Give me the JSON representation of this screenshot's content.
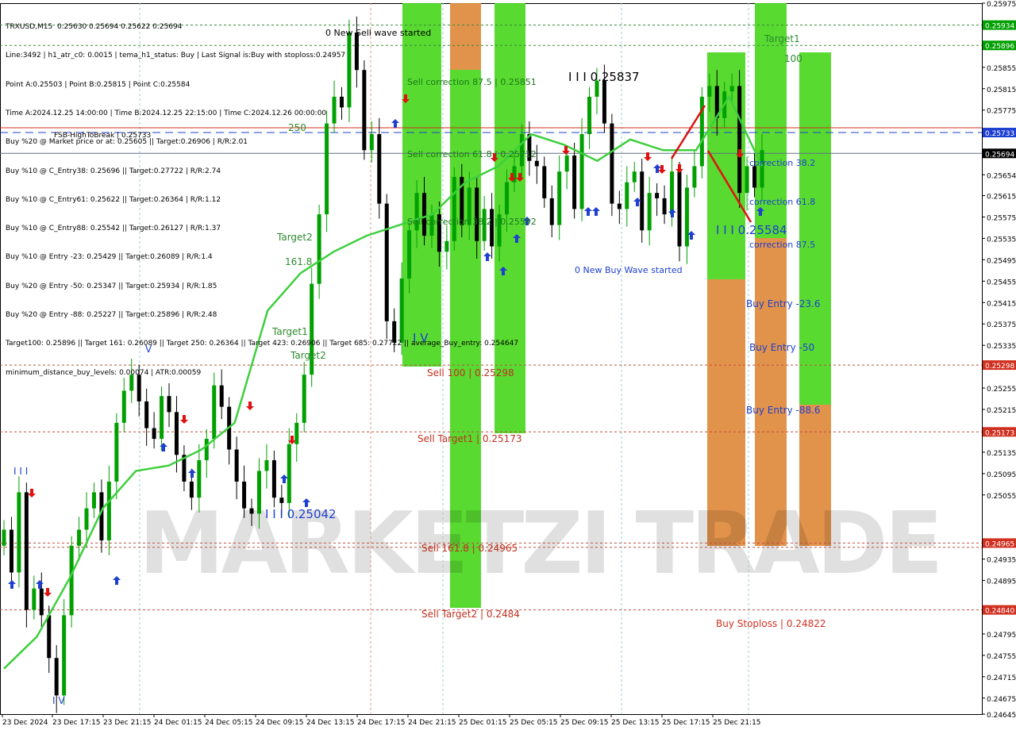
{
  "header_lines": [
    "TRXUSD,M15  0.25630 0.25694 0.25622 0.25694",
    "Line:3492 | h1_atr_c0: 0.0015 | tema_h1_status: Buy | Last Signal is:Buy with stoploss:0.24957",
    "Point A:0.25503 | Point B:0.25815 | Point C:0.25584",
    "Time A:2024.12.25 14:00:00 | Time B:2024.12.25 22:15:00 | Time C:2024.12.26 00:00:00",
    "Buy %20 @ Market price or at: 0.25605 || Target:0.26906 | R/R:2.01",
    "Buy %10 @ C_Entry38: 0.25696 || Target:0.27722 | R/R:2.74",
    "Buy %10 @ C_Entry61: 0.25622 || Target:0.26364 | R/R:1.12",
    "Buy %10 @ C_Entry88: 0.25542 || Target:0.26127 | R/R:1.37",
    "Buy %10 @ Entry -23: 0.25429 || Target:0.26089 | R/R:1.4",
    "Buy %20 @ Entry -50: 0.25347 || Target:0.25934 | R/R:1.85",
    "Buy %20 @ Entry -88: 0.25227 || Target:0.25896 | R/R:2.48",
    "Target100: 0.25896 || Target 161: 0.26089 || Target 250: 0.26364 || Target 423: 0.26906 || Target 685: 0.27722 || average_Buy_entry: 0.254647",
    "minimum_distance_buy_levels: 0.00074 | ATR:0.00059"
  ],
  "chart_data": {
    "type": "candlestick",
    "symbol": "TRXUSD",
    "timeframe": "M15",
    "ylim": [
      0.24645,
      0.25975
    ],
    "y_ticks": [
      "0.25975",
      "0.25934",
      "0.25896",
      "0.25855",
      "0.25815",
      "0.25775",
      "0.25733",
      "0.25694",
      "0.25654",
      "0.25615",
      "0.25575",
      "0.25535",
      "0.25495",
      "0.25455",
      "0.25415",
      "0.25375",
      "0.25335",
      "0.25298",
      "0.25255",
      "0.25215",
      "0.25173",
      "0.25135",
      "0.25095",
      "0.25055",
      "0.24965",
      "0.24935",
      "0.24895",
      "0.24840",
      "0.24795",
      "0.24755",
      "0.24715",
      "0.24675",
      "0.24645"
    ],
    "x_ticks": [
      "23 Dec 2024",
      "23 Dec 17:15",
      "23 Dec 21:15",
      "24 Dec 01:15",
      "24 Dec 05:15",
      "24 Dec 09:15",
      "24 Dec 13:15",
      "24 Dec 17:15",
      "24 Dec 21:15",
      "25 Dec 01:15",
      "25 Dec 05:15",
      "25 Dec 09:15",
      "25 Dec 13:15",
      "25 Dec 17:15",
      "25 Dec 21:15"
    ],
    "current_price": "0.25694",
    "price_labels": [
      {
        "value": 0.25934,
        "text": "0.25934",
        "color": "#00a000"
      },
      {
        "value": 0.25896,
        "text": "0.25896",
        "color": "#00a000"
      },
      {
        "value": 0.25733,
        "text": "0.25733",
        "color": "#1e3fd0"
      },
      {
        "value": 0.25694,
        "text": "0.25694",
        "color": "#000000"
      },
      {
        "value": 0.25298,
        "text": "0.25298",
        "color": "#d03020"
      },
      {
        "value": 0.25173,
        "text": "0.25173",
        "color": "#d03020"
      },
      {
        "value": 0.24965,
        "text": "0.24965",
        "color": "#d03020"
      },
      {
        "value": 0.2484,
        "text": "0.24840",
        "color": "#d03020"
      }
    ],
    "series": [
      {
        "name": "close",
        "values": [
          0.2499,
          0.2491,
          0.2506,
          0.2484,
          0.2488,
          0.2483,
          0.2475,
          0.2468,
          0.2483,
          0.2496,
          0.2499,
          0.2503,
          0.2506,
          0.2497,
          0.2508,
          0.2519,
          0.2525,
          0.2528,
          0.2523,
          0.2518,
          0.2516,
          0.2524,
          0.2521,
          0.2513,
          0.2508,
          0.2505,
          0.2512,
          0.2516,
          0.2526,
          0.2522,
          0.2514,
          0.2508,
          0.2503,
          0.2502,
          0.251,
          0.2512,
          0.2505,
          0.2504,
          0.2515,
          0.2519,
          0.2528,
          0.2545,
          0.2558,
          0.2575,
          0.258,
          0.2578,
          0.2592,
          0.2585,
          0.257,
          0.2573,
          0.256,
          0.2538,
          0.2534,
          0.2546,
          0.2555,
          0.2562,
          0.2554,
          0.2558,
          0.2551,
          0.2553,
          0.2565,
          0.2556,
          0.2563,
          0.2553,
          0.2559,
          0.2552,
          0.2558,
          0.2564,
          0.2567,
          0.2573,
          0.2568,
          0.2567,
          0.2561,
          0.2556,
          0.2566,
          0.2569,
          0.2559,
          0.2573,
          0.258,
          0.2583,
          0.2575,
          0.256,
          0.2559,
          0.2564,
          0.2566,
          0.2555,
          0.2562,
          0.2561,
          0.2558,
          0.2566,
          0.2552,
          0.2563,
          0.2567,
          0.258,
          0.2582,
          0.2576,
          0.2581,
          0.2582,
          0.2562,
          0.2567,
          0.2563,
          0.257
        ]
      },
      {
        "name": "moving_average",
        "values": [
          0.2473,
          0.2479,
          0.249,
          0.2503,
          0.251,
          0.2511,
          0.2514,
          0.2519,
          0.254,
          0.2547,
          0.2551,
          0.2554,
          0.2556,
          0.2558,
          0.2564,
          0.2567,
          0.2573,
          0.2571,
          0.2568,
          0.2572,
          0.257,
          0.257,
          0.258,
          0.2567
        ]
      }
    ],
    "zones": [
      {
        "label": "Target1",
        "value_text": "100"
      },
      {
        "label": "Target2",
        "value_text": "161.8"
      }
    ],
    "annotations": [
      {
        "text": "0 New Sell wave started",
        "color": "#000000"
      },
      {
        "text": "Sell correction 87.5 | 0.25851",
        "color": "#1a7a1a"
      },
      {
        "text": "Sell correction 61.8 | 0.25712",
        "color": "#1a7a1a"
      },
      {
        "text": "Sell correction 38.2 | 0.25592",
        "color": "#1a7a1a"
      },
      {
        "text": "Sell 100 | 0.25298",
        "color": "#c03020"
      },
      {
        "text": "Sell Target1 | 0.25173",
        "color": "#c03020"
      },
      {
        "text": "Sell 161.8 | 0.24965",
        "color": "#c03020"
      },
      {
        "text": "Sell Target2 | 0.2484",
        "color": "#c03020"
      },
      {
        "text": "I I I 0.25837",
        "color": "#000000"
      },
      {
        "text": "I I I 0.25584",
        "color": "#1e3fd0"
      },
      {
        "text": "I I I 0.25042",
        "color": "#1e3fd0"
      },
      {
        "text": "0 New Buy Wave started",
        "color": "#1e3fd0"
      },
      {
        "text": "correction 38.2",
        "color": "#1e3fd0"
      },
      {
        "text": "correction 61.8",
        "color": "#1e3fd0"
      },
      {
        "text": "correction 87.5",
        "color": "#1e3fd0"
      },
      {
        "text": "Buy Entry -23.6",
        "color": "#1e3fd0"
      },
      {
        "text": "Buy Entry -50",
        "color": "#1e3fd0"
      },
      {
        "text": "Buy Entry -88.6",
        "color": "#1e3fd0"
      },
      {
        "text": "Buy Stoploss | 0.24822",
        "color": "#d03020"
      },
      {
        "text": "FSB-HighToBreak | 0.25733",
        "color": "#000000"
      },
      {
        "text": "Target1",
        "color": "#2e8b2e"
      },
      {
        "text": "100",
        "color": "#2e8b2e"
      },
      {
        "text": "Target2",
        "color": "#2e8b2e"
      },
      {
        "text": "161.8",
        "color": "#2e8b2e"
      },
      {
        "text": "250",
        "color": "#2e8b2e"
      },
      {
        "text": "I V",
        "color": "#1e3fd0"
      },
      {
        "text": "I V",
        "color": "#1e3fd0"
      },
      {
        "text": "V",
        "color": "#1e3fd0"
      },
      {
        "text": "I I I",
        "color": "#1e3fd0"
      }
    ],
    "watermark": "MARKETZI TRADE",
    "grid": true,
    "colors": {
      "bull": "#00a000",
      "bear": "#000000",
      "green_zone": "#4ad71e",
      "orange_zone": "#e08a3c",
      "ma": "#3ecf3e",
      "sell_line": "#c83a2a",
      "buy_line": "#1e3fd0"
    }
  }
}
